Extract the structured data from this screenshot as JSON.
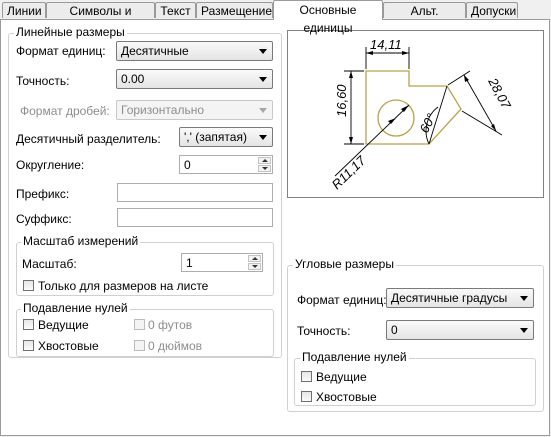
{
  "tabs": [
    {
      "label": "Линии"
    },
    {
      "label": "Символы и стрелки"
    },
    {
      "label": "Текст"
    },
    {
      "label": "Размещение"
    },
    {
      "label": "Основные единицы"
    },
    {
      "label": "Альт. единицы"
    },
    {
      "label": "Допуски"
    }
  ],
  "active_tab": "Основные единицы",
  "linear": {
    "title": "Линейные размеры",
    "unit_format_label": "Формат единиц:",
    "unit_format_value": "Десятичные",
    "precision_label": "Точность:",
    "precision_value": "0.00",
    "fraction_format_label": "Формат дробей:",
    "fraction_format_value": "Горизонтально",
    "decimal_separator_label": "Десятичный  разделитель:",
    "decimal_separator_value": "',' (запятая)",
    "round_off_label": "Округление:",
    "round_off_value": "0",
    "prefix_label": "Префикс:",
    "prefix_value": "",
    "suffix_label": "Суффикс:",
    "suffix_value": ""
  },
  "measurement_scale": {
    "title": "Масштаб измерений",
    "scale_label": "Масштаб:",
    "scale_value": "1",
    "layout_only_label": "Только для размеров на листе"
  },
  "linear_zero_suppression": {
    "title": "Подавление нулей",
    "leading_label": "Ведущие",
    "trailing_label": "Хвостовые",
    "feet_label": "0 футов",
    "inches_label": "0 дюймов"
  },
  "preview": {
    "dim_top": "14,11",
    "dim_left": "16,60",
    "dim_right": "28,07",
    "dim_angle": "60°",
    "dim_radius": "R11,17",
    "accent_color": "#b8a24a"
  },
  "angular": {
    "title": "Угловые размеры",
    "unit_format_label": "Формат единиц:",
    "unit_format_value": "Десятичные градусы",
    "precision_label": "Точность:",
    "precision_value": "0"
  },
  "angular_zero_suppression": {
    "title": "Подавление нулей",
    "leading_label": "Ведущие",
    "trailing_label": "Хвостовые"
  }
}
